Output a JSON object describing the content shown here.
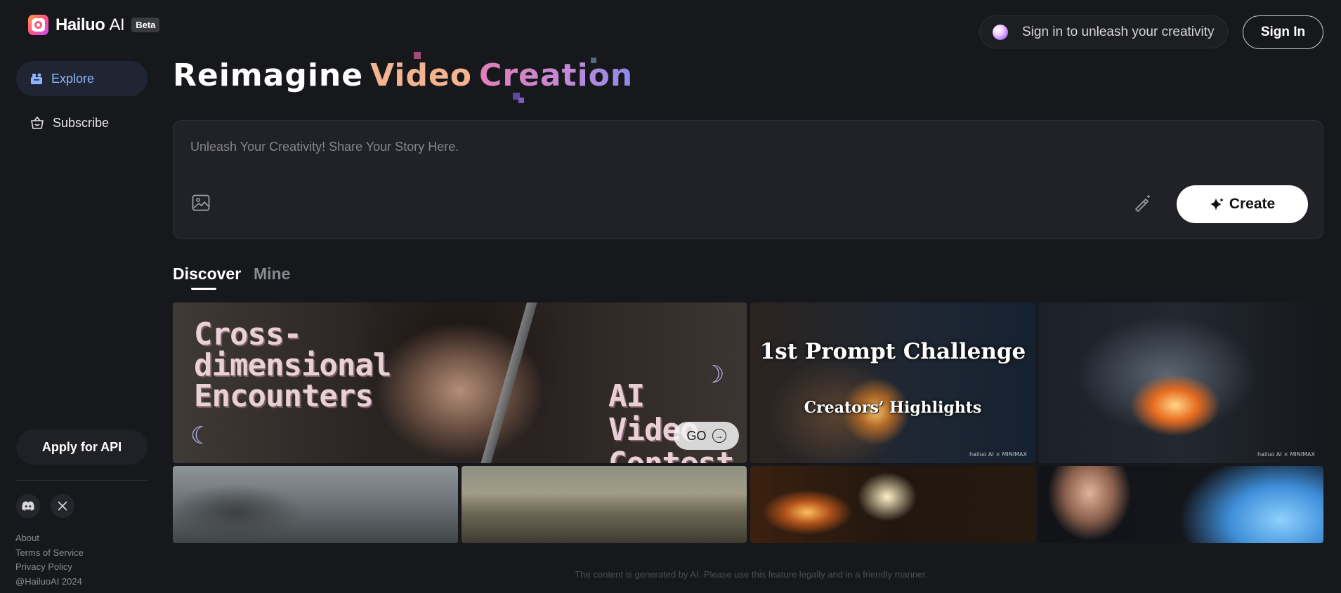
{
  "brand": {
    "name": "Hailuo",
    "name_suffix": "AI",
    "badge": "Beta"
  },
  "sidebar": {
    "nav": [
      {
        "label": "Explore",
        "icon": "explore-icon",
        "active": true
      },
      {
        "label": "Subscribe",
        "icon": "basket-icon",
        "active": false
      }
    ],
    "api_button": "Apply for API",
    "social": [
      "discord-icon",
      "x-icon"
    ],
    "footer_links": [
      "About",
      "Terms of Service",
      "Privacy Policy",
      "@HailuoAI 2024"
    ]
  },
  "header": {
    "signin_prompt": "Sign in to unleash your creativity",
    "signin_button": "Sign In"
  },
  "hero": {
    "word1": "Reimagine",
    "word2": "Video",
    "word3": "Creation"
  },
  "prompt": {
    "placeholder": "Unleash Your Creativity! Share Your Story Here.",
    "value": "",
    "create_label": "Create"
  },
  "tabs": [
    {
      "label": "Discover",
      "active": true
    },
    {
      "label": "Mine",
      "active": false
    }
  ],
  "gallery": {
    "banner": {
      "title_left_1": "Cross-",
      "title_left_2": "dimensional",
      "title_left_3": "Encounters",
      "title_right_1": "AI Video",
      "title_right_2": "Contest",
      "go_label": "GO"
    },
    "challenge": {
      "title": "1st Prompt Challenge",
      "subtitle": "Creators’ Highlights",
      "watermark": "hailuo AI × MINIMAX"
    },
    "fire_watermark": "hailuo AI × MINIMAX"
  },
  "disclaimer": "The content is generated by AI. Please use this feature legally and in a friendly manner.",
  "colors": {
    "background": "#17181c",
    "accent_blue": "#8fb3ff",
    "headline_video": "#f3b48f",
    "headline_creation_start": "#e17fb7",
    "headline_creation_end": "#8d8be8"
  }
}
